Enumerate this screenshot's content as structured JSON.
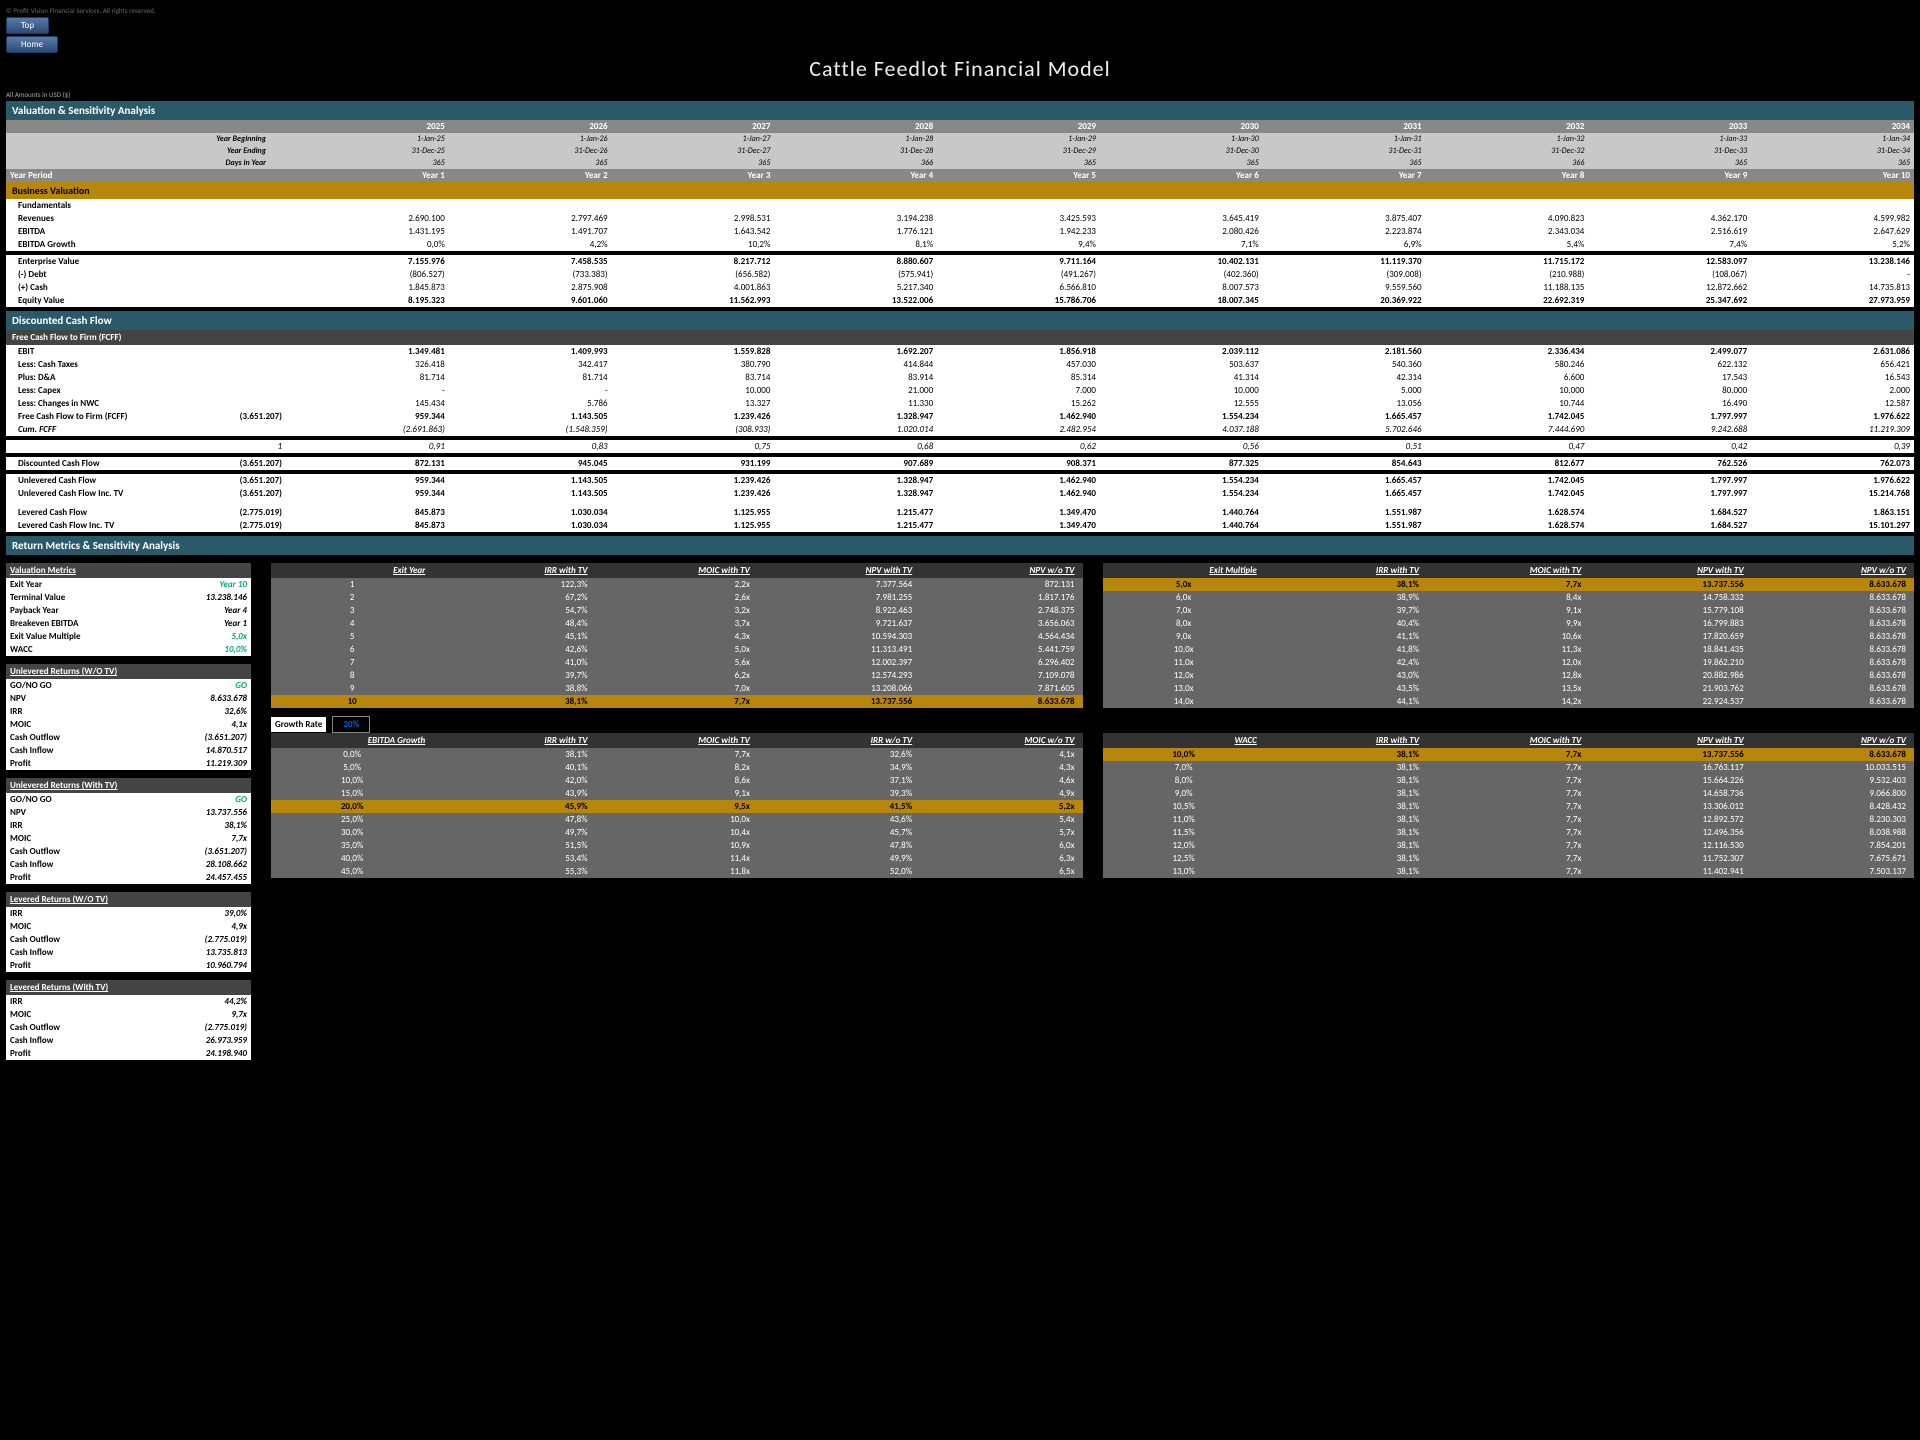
{
  "copyright": "© Profit Vision Financial Services. All rights reserved.",
  "btn_top": "Top",
  "btn_home": "Home",
  "title": "Cattle Feedlot Financial Model",
  "amounts": "All Amounts in  USD ($)",
  "section_val": "Valuation & Sensitivity Analysis",
  "years": [
    "2025",
    "2026",
    "2027",
    "2028",
    "2029",
    "2030",
    "2031",
    "2032",
    "2033",
    "2034"
  ],
  "hdr_rows": [
    [
      "Year Beginning",
      "1-Jan-25",
      "1-Jan-26",
      "1-Jan-27",
      "1-Jan-28",
      "1-Jan-29",
      "1-Jan-30",
      "1-Jan-31",
      "1-Jan-32",
      "1-Jan-33",
      "1-Jan-34"
    ],
    [
      "Year Ending",
      "31-Dec-25",
      "31-Dec-26",
      "31-Dec-27",
      "31-Dec-28",
      "31-Dec-29",
      "31-Dec-30",
      "31-Dec-31",
      "31-Dec-32",
      "31-Dec-33",
      "31-Dec-34"
    ],
    [
      "Days in Year",
      "365",
      "365",
      "365",
      "366",
      "365",
      "365",
      "365",
      "366",
      "365",
      "365"
    ],
    [
      "Year Period",
      "Year 1",
      "Year 2",
      "Year 3",
      "Year 4",
      "Year 5",
      "Year 6",
      "Year 7",
      "Year 8",
      "Year 9",
      "Year 10"
    ]
  ],
  "band_bv": "Business Valuation",
  "bv_rows": [
    [
      "Fundamentals",
      "",
      "",
      "",
      "",
      "",
      "",
      "",
      "",
      "",
      ""
    ],
    [
      "Revenues",
      "2.690.100",
      "2.797.469",
      "2.998.531",
      "3.194.238",
      "3.425.593",
      "3.645.419",
      "3.875.407",
      "4.090.823",
      "4.362.170",
      "4.599.982"
    ],
    [
      "EBITDA",
      "1.431.195",
      "1.491.707",
      "1.643.542",
      "1.776.121",
      "1.942.233",
      "2.080.426",
      "2.223.874",
      "2.343.034",
      "2.516.619",
      "2.647.629"
    ],
    [
      "EBITDA Growth",
      "0,0%",
      "4,2%",
      "10,2%",
      "8,1%",
      "9,4%",
      "7,1%",
      "6,9%",
      "5,4%",
      "7,4%",
      "5,2%"
    ]
  ],
  "ev_rows": [
    [
      "Enterprise Value",
      "7.155.976",
      "7.458.535",
      "8.217.712",
      "8.880.607",
      "9.711.164",
      "10.402.131",
      "11.119.370",
      "11.715.172",
      "12.583.097",
      "13.238.146"
    ],
    [
      "(-) Debt",
      "(806.527)",
      "(733.383)",
      "(656.582)",
      "(575.941)",
      "(491.267)",
      "(402.360)",
      "(309.008)",
      "(210.988)",
      "(108.067)",
      "-"
    ],
    [
      "(+) Cash",
      "1.845.873",
      "2.875.908",
      "4.001.863",
      "5.217.340",
      "6.566.810",
      "8.007.573",
      "9.559.560",
      "11.188.135",
      "12.872.662",
      "14.735.813"
    ],
    [
      "Equity Value",
      "8.195.323",
      "9.601.060",
      "11.562.993",
      "13.522.006",
      "15.786.706",
      "18.007.345",
      "20.369.922",
      "22.692.319",
      "25.347.692",
      "27.973.959"
    ]
  ],
  "band_dcf": "Discounted Cash Flow",
  "band_fcff": "Free Cash Flow to Firm (FCFF)",
  "fcff_rows": [
    [
      "EBIT",
      "1.349.481",
      "1.409.993",
      "1.559.828",
      "1.692.207",
      "1.856.918",
      "2.039.112",
      "2.181.560",
      "2.336.434",
      "2.499.077",
      "2.631.086"
    ],
    [
      "Less: Cash Taxes",
      "326.418",
      "342.417",
      "380.790",
      "414.844",
      "457.030",
      "503.637",
      "540.360",
      "580.246",
      "622.132",
      "656.421"
    ],
    [
      "Plus: D&A",
      "81.714",
      "81.714",
      "83.714",
      "83.914",
      "85.314",
      "41.314",
      "42.314",
      "6.600",
      "17.543",
      "16.543"
    ],
    [
      "Less: Capex",
      "-",
      "-",
      "10.000",
      "21.000",
      "7.000",
      "10.000",
      "5.000",
      "10.000",
      "80.000",
      "2.000"
    ],
    [
      "Less: Changes in NWC",
      "145.434",
      "5.786",
      "13.327",
      "11.330",
      "15.262",
      "12.555",
      "13.056",
      "10.744",
      "16.490",
      "12.587"
    ],
    [
      "Free Cash Flow to Firm (FCFF)",
      "959.344",
      "1.143.505",
      "1.239.426",
      "1.328.947",
      "1.462.940",
      "1.554.234",
      "1.665.457",
      "1.742.045",
      "1.797.997",
      "1.976.622"
    ],
    [
      "Cum. FCFF",
      "(2.691.863)",
      "(1.548.359)",
      "(308.933)",
      "1.020.014",
      "2.482.954",
      "4.037.188",
      "5.702.646",
      "7.444.690",
      "9.242.688",
      "11.219.309"
    ]
  ],
  "fcff_init": "(3.651.207)",
  "disc_factors": [
    "1",
    "0,91",
    "0,83",
    "0,75",
    "0,68",
    "0,62",
    "0,56",
    "0,51",
    "0,47",
    "0,42",
    "0,39"
  ],
  "dcf_rows": [
    [
      "Discounted Cash Flow",
      "(3.651.207)",
      "872.131",
      "945.045",
      "931.199",
      "907.689",
      "908.371",
      "877.325",
      "854.643",
      "812.677",
      "762.526",
      "762.073"
    ]
  ],
  "cf_rows": [
    [
      "Unlevered Cash Flow",
      "(3.651.207)",
      "959.344",
      "1.143.505",
      "1.239.426",
      "1.328.947",
      "1.462.940",
      "1.554.234",
      "1.665.457",
      "1.742.045",
      "1.797.997",
      "1.976.622"
    ],
    [
      "Unlevered Cash Flow Inc. TV",
      "(3.651.207)",
      "959.344",
      "1.143.505",
      "1.239.426",
      "1.328.947",
      "1.462.940",
      "1.554.234",
      "1.665.457",
      "1.742.045",
      "1.797.997",
      "15.214.768"
    ],
    [
      "Levered Cash Flow",
      "(2.775.019)",
      "845.873",
      "1.030.034",
      "1.125.955",
      "1.215.477",
      "1.349.470",
      "1.440.764",
      "1.551.987",
      "1.628.574",
      "1.684.527",
      "1.863.151"
    ],
    [
      "Levered Cash Flow Inc. TV",
      "(2.775.019)",
      "845.873",
      "1.030.034",
      "1.125.955",
      "1.215.477",
      "1.349.470",
      "1.440.764",
      "1.551.987",
      "1.628.574",
      "1.684.527",
      "15.101.297"
    ]
  ],
  "band_rm": "Return Metrics & Sensitivity Analysis",
  "vm_hdr": "Valuation Metrics",
  "vm": [
    [
      "Exit Year",
      "Year 10"
    ],
    [
      "Terminal Value",
      "13.238.146"
    ],
    [
      "Payback Year",
      "Year 4"
    ],
    [
      "Breakeven EBITDA",
      "Year 1"
    ],
    [
      "Exit Value Multiple",
      "5,0x"
    ],
    [
      "WACC",
      "10,0%"
    ]
  ],
  "ur_hdr": "Unlevered Returns (W/O TV)",
  "ur": [
    [
      "GO/NO GO",
      "GO"
    ],
    [
      "NPV",
      "8.633.678"
    ],
    [
      "IRR",
      "32,6%"
    ],
    [
      "MOIC",
      "4,1x"
    ],
    [
      "Cash Outflow",
      "(3.651.207)"
    ],
    [
      "Cash Inflow",
      "14.870.517"
    ],
    [
      "Profit",
      "11.219.309"
    ]
  ],
  "urt_hdr": "Unlevered Returns (With TV)",
  "urt": [
    [
      "GO/NO GO",
      "GO"
    ],
    [
      "NPV",
      "13.737.556"
    ],
    [
      "IRR",
      "38,1%"
    ],
    [
      "MOIC",
      "7,7x"
    ],
    [
      "Cash Outflow",
      "(3.651.207)"
    ],
    [
      "Cash Inflow",
      "28.108.662"
    ],
    [
      "Profit",
      "24.457.455"
    ]
  ],
  "lr_hdr": "Levered Returns (W/O TV)",
  "lr": [
    [
      "IRR",
      "39,0%"
    ],
    [
      "MOIC",
      "4,9x"
    ],
    [
      "Cash Outflow",
      "(2.775.019)"
    ],
    [
      "Cash Inflow",
      "13.735.813"
    ],
    [
      "Profit",
      "10.960.794"
    ]
  ],
  "lrt_hdr": "Levered Returns (With TV)",
  "lrt": [
    [
      "IRR",
      "44,2%"
    ],
    [
      "MOIC",
      "9,7x"
    ],
    [
      "Cash Outflow",
      "(2.775.019)"
    ],
    [
      "Cash Inflow",
      "26.973.959"
    ],
    [
      "Profit",
      "24.198.940"
    ]
  ],
  "sens_ey_hdr": [
    "Exit Year",
    "IRR with TV",
    "MOIC with TV",
    "NPV with TV",
    "NPV w/o TV"
  ],
  "sens_ey": [
    [
      "1",
      "122,3%",
      "2,2x",
      "7.377.564",
      "872.131"
    ],
    [
      "2",
      "67,2%",
      "2,6x",
      "7.981.255",
      "1.817.176"
    ],
    [
      "3",
      "54,7%",
      "3,2x",
      "8.922.463",
      "2.748.375"
    ],
    [
      "4",
      "48,4%",
      "3,7x",
      "9.721.637",
      "3.656.063"
    ],
    [
      "5",
      "45,1%",
      "4,3x",
      "10.594.303",
      "4.564.434"
    ],
    [
      "6",
      "42,6%",
      "5,0x",
      "11.313.491",
      "5.441.759"
    ],
    [
      "7",
      "41,0%",
      "5,6x",
      "12.002.397",
      "6.296.402"
    ],
    [
      "8",
      "39,7%",
      "6,2x",
      "12.574.293",
      "7.109.078"
    ],
    [
      "9",
      "38,8%",
      "7,0x",
      "13.208.066",
      "7.871.605"
    ],
    [
      "10",
      "38,1%",
      "7,7x",
      "13.737.556",
      "8.633.678"
    ]
  ],
  "sens_em_hdr": [
    "Exit Multiple",
    "IRR with TV",
    "MOIC with TV",
    "NPV with TV",
    "NPV w/o TV"
  ],
  "sens_em": [
    [
      "5,0x",
      "38,1%",
      "7,7x",
      "13.737.556",
      "8.633.678"
    ],
    [
      "6,0x",
      "38,9%",
      "8,4x",
      "14.758.332",
      "8.633.678"
    ],
    [
      "7,0x",
      "39,7%",
      "9,1x",
      "15.779.108",
      "8.633.678"
    ],
    [
      "8,0x",
      "40,4%",
      "9,9x",
      "16.799.883",
      "8.633.678"
    ],
    [
      "9,0x",
      "41,1%",
      "10,6x",
      "17.820.659",
      "8.633.678"
    ],
    [
      "10,0x",
      "41,8%",
      "11,3x",
      "18.841.435",
      "8.633.678"
    ],
    [
      "11,0x",
      "42,4%",
      "12,0x",
      "19.862.210",
      "8.633.678"
    ],
    [
      "12,0x",
      "43,0%",
      "12,8x",
      "20.882.986",
      "8.633.678"
    ],
    [
      "13,0x",
      "43,5%",
      "13,5x",
      "21.903.762",
      "8.633.678"
    ],
    [
      "14,0x",
      "44,1%",
      "14,2x",
      "22.924.537",
      "8.633.678"
    ]
  ],
  "growth_label": "Growth Rate",
  "growth_val": "20%",
  "sens_eg_hdr": [
    "EBITDA Growth",
    "IRR with TV",
    "MOIC with TV",
    "IRR w/o TV",
    "MOIC w/o TV"
  ],
  "sens_eg": [
    [
      "0,0%",
      "38,1%",
      "7,7x",
      "32,6%",
      "4,1x"
    ],
    [
      "5,0%",
      "40,1%",
      "8,2x",
      "34,9%",
      "4,3x"
    ],
    [
      "10,0%",
      "42,0%",
      "8,6x",
      "37,1%",
      "4,6x"
    ],
    [
      "15,0%",
      "43,9%",
      "9,1x",
      "39,3%",
      "4,9x"
    ],
    [
      "20,0%",
      "45,9%",
      "9,5x",
      "41,5%",
      "5,2x"
    ],
    [
      "25,0%",
      "47,8%",
      "10,0x",
      "43,6%",
      "5,4x"
    ],
    [
      "30,0%",
      "49,7%",
      "10,4x",
      "45,7%",
      "5,7x"
    ],
    [
      "35,0%",
      "51,5%",
      "10,9x",
      "47,8%",
      "6,0x"
    ],
    [
      "40,0%",
      "53,4%",
      "11,4x",
      "49,9%",
      "6,3x"
    ],
    [
      "45,0%",
      "55,3%",
      "11,8x",
      "52,0%",
      "6,5x"
    ]
  ],
  "sens_wacc_hdr": [
    "WACC",
    "IRR with TV",
    "MOIC with TV",
    "NPV with TV",
    "NPV w/o TV"
  ],
  "sens_wacc": [
    [
      "10,0%",
      "38,1%",
      "7,7x",
      "13.737.556",
      "8.633.678"
    ],
    [
      "7,0%",
      "38,1%",
      "7,7x",
      "16.763.117",
      "10.033.515"
    ],
    [
      "8,0%",
      "38,1%",
      "7,7x",
      "15.664.226",
      "9.532.403"
    ],
    [
      "9,0%",
      "38,1%",
      "7,7x",
      "14.658.736",
      "9.066.800"
    ],
    [
      "10,5%",
      "38,1%",
      "7,7x",
      "13.306.012",
      "8.428.432"
    ],
    [
      "11,0%",
      "38,1%",
      "7,7x",
      "12.892.572",
      "8.230.303"
    ],
    [
      "11,5%",
      "38,1%",
      "7,7x",
      "12.496.356",
      "8.038.988"
    ],
    [
      "12,0%",
      "38,1%",
      "7,7x",
      "12.116.530",
      "7.854.201"
    ],
    [
      "12,5%",
      "38,1%",
      "7,7x",
      "11.752.307",
      "7.675.671"
    ],
    [
      "13,0%",
      "38,1%",
      "7,7x",
      "11.402.941",
      "7.503.137"
    ]
  ]
}
